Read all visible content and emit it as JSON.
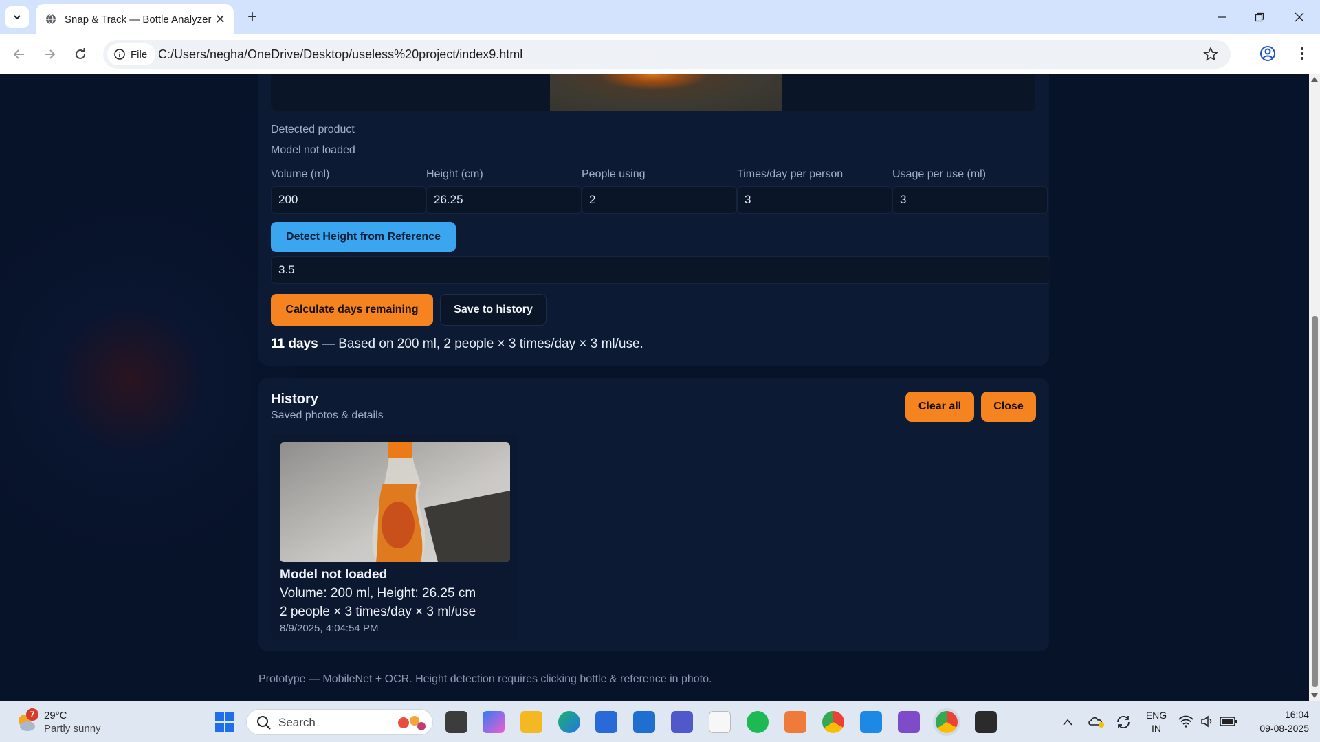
{
  "browser": {
    "tab_title": "Snap & Track — Bottle Analyzer",
    "site_chip": "File",
    "url": "C:/Users/negha/OneDrive/Desktop/useless%20project/index9.html"
  },
  "analyzer": {
    "detected_label": "Detected product",
    "detected_value": "Model not loaded",
    "fields": [
      {
        "label": "Volume (ml)",
        "value": "200"
      },
      {
        "label": "Height (cm)",
        "value": "26.25"
      },
      {
        "label": "People using",
        "value": "2"
      },
      {
        "label": "Times/day per person",
        "value": "3"
      },
      {
        "label": "Usage per use (ml)",
        "value": "3"
      }
    ],
    "detect_button": "Detect Height from Reference",
    "reference_value": "3.5",
    "calculate_button": "Calculate days remaining",
    "save_button": "Save to history",
    "result_days": "11 days",
    "result_detail": " — Based on 200 ml, 2 people × 3 times/day × 3 ml/use."
  },
  "history": {
    "title": "History",
    "subtitle": "Saved photos & details",
    "clear_button": "Clear all",
    "close_button": "Close",
    "items": [
      {
        "product": "Model not loaded",
        "dims": "Volume: 200 ml, Height: 26.25 cm",
        "usage": "2 people × 3 times/day × 3 ml/use",
        "timestamp": "8/9/2025, 4:04:54 PM"
      }
    ]
  },
  "footer": "Prototype — MobileNet + OCR. Height detection requires clicking bottle & reference in photo.",
  "taskbar": {
    "weather_badge": "7",
    "temperature": "29°C",
    "weather": "Partly sunny",
    "search_placeholder": "Search",
    "lang_1": "ENG",
    "lang_2": "IN",
    "time": "16:04",
    "date": "09-08-2025"
  },
  "colors": {
    "accent_orange": "#f5831f",
    "accent_blue": "#3aa6ef",
    "page_bg": "#081428",
    "card_bg": "#0d1a33"
  }
}
